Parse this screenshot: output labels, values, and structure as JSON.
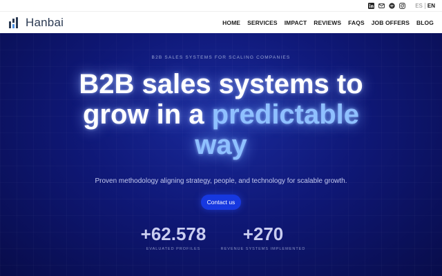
{
  "utility": {
    "social_icons": [
      "linkedin-icon",
      "email-icon",
      "spotify-icon",
      "instagram-icon"
    ],
    "lang_es": "ES",
    "lang_en": "EN"
  },
  "nav": {
    "brand": "Hanbai",
    "items": [
      "HOME",
      "SERVICES",
      "IMPACT",
      "REVIEWS",
      "FAQS",
      "JOB OFFERS",
      "BLOG"
    ]
  },
  "hero": {
    "eyebrow": "B2B SALES SYSTEMS FOR SCALING COMPANIES",
    "headline_line1": "B2B sales systems to",
    "headline_line2_a": "grow in a ",
    "headline_line2_b": "predictable",
    "headline_line3": "way",
    "subtitle": "Proven methodology aligning strategy, people, and technology for scalable growth.",
    "cta": "Contact us",
    "stats": [
      {
        "value": "+62.578",
        "label": "EVALUATED PROFILES"
      },
      {
        "value": "+270",
        "label": "REVENUE SYSTEMS IMPLEMENTED"
      }
    ]
  },
  "colors": {
    "hero_bg": "#0f1877",
    "accent": "#1638e0",
    "highlight_text": "#8fc0ff",
    "brand_text": "#2b3a52"
  }
}
